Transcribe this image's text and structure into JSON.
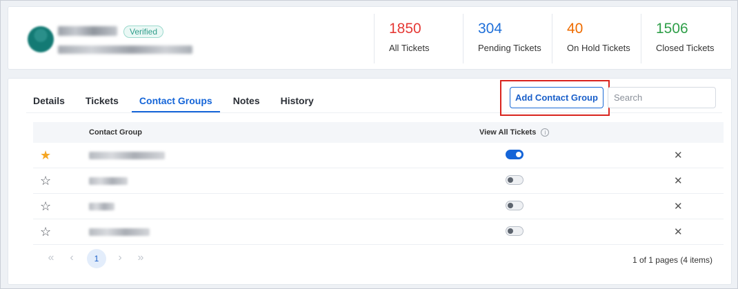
{
  "profile": {
    "badge": "Verified"
  },
  "stats": [
    {
      "value": "1850",
      "label": "All Tickets",
      "color": "#e53935"
    },
    {
      "value": "304",
      "label": "Pending Tickets",
      "color": "#1e6fd9"
    },
    {
      "value": "40",
      "label": "On Hold Tickets",
      "color": "#ef6c00"
    },
    {
      "value": "1506",
      "label": "Closed Tickets",
      "color": "#2e9e48"
    }
  ],
  "tabs": [
    {
      "label": "Details"
    },
    {
      "label": "Tickets"
    },
    {
      "label": "Contact Groups",
      "active": true
    },
    {
      "label": "Notes"
    },
    {
      "label": "History"
    }
  ],
  "toolbar": {
    "add_label": "Add Contact Group",
    "search_placeholder": "Search"
  },
  "table": {
    "col_group": "Contact Group",
    "col_view": "View All Tickets",
    "rows": [
      {
        "starred": true,
        "view_all": true,
        "remove_icon": "close-icon"
      },
      {
        "starred": false,
        "view_all": false,
        "remove_icon": "close-icon"
      },
      {
        "starred": false,
        "view_all": false,
        "remove_icon": "close-icon"
      },
      {
        "starred": false,
        "view_all": false,
        "remove_icon": "close-icon"
      }
    ]
  },
  "pagination": {
    "current": "1",
    "info": "1 of 1 pages (4 items)"
  },
  "colors": {
    "accent": "#1565d8",
    "highlight": "#d9231d",
    "star": "#f5a623"
  }
}
